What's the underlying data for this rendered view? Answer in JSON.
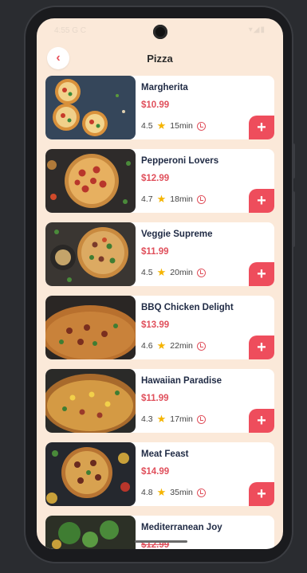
{
  "status": {
    "time": "4:55 G C",
    "icons": "▾◢▮"
  },
  "header": {
    "title": "Pizza",
    "back_icon": "chevron-left-icon"
  },
  "colors": {
    "accent": "#ee4d5c",
    "price": "#e0505c",
    "background": "#fbe9d9",
    "star": "#f5b400"
  },
  "items": [
    {
      "name": "Margherita",
      "price": "$10.99",
      "rating": "4.5",
      "time": "15min"
    },
    {
      "name": "Pepperoni Lovers",
      "price": "$12.99",
      "rating": "4.7",
      "time": "18min"
    },
    {
      "name": "Veggie Supreme",
      "price": "$11.99",
      "rating": "4.5",
      "time": "20min"
    },
    {
      "name": "BBQ Chicken Delight",
      "price": "$13.99",
      "rating": "4.6",
      "time": "22min"
    },
    {
      "name": "Hawaiian Paradise",
      "price": "$11.99",
      "rating": "4.3",
      "time": "17min"
    },
    {
      "name": "Meat Feast",
      "price": "$14.99",
      "rating": "4.8",
      "time": "35min"
    },
    {
      "name": "Mediterranean Joy",
      "price": "$12.99",
      "rating": "",
      "time": ""
    }
  ],
  "add_label": "+"
}
